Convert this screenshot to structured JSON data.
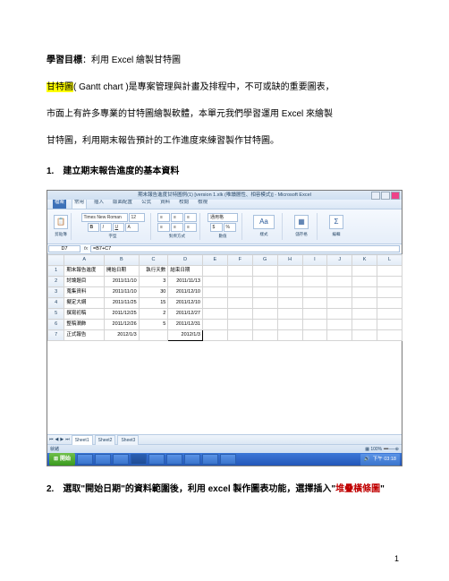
{
  "doc": {
    "heading_prefix": "學習目標",
    "heading_rest": "：利用 Excel 繪製甘特圖",
    "para1a": "甘特圖",
    "para1b": "( Gantt chart )是專案管理與計畫及排程中，不可或缺的重要圖表，",
    "para2": "市面上有許多專業的甘特圖繪製軟體，本單元我們學習運用 Excel 來繪製",
    "para3": "甘特圖，利用期末報告預計的工作進度來練習製作甘特圖。",
    "sec1": "1.　建立期末報告進度的基本資料",
    "sec2a": "2.　選取\"開始日期\"的資料範圍後，利用 excel 製作圖表功能，選擇插入\"",
    "sec2b": "堆疊橫條圖",
    "sec2c": "\"",
    "page_number": "1"
  },
  "excel": {
    "title": "期末報告進度甘特圖例(1) [version 1.xlk (唯讀層性、相容模式)] - Microsoft Excel",
    "qat": [
      "檔案",
      "常用",
      "插入",
      "版面配置",
      "公式",
      "資料",
      "校閱",
      "檢視"
    ],
    "font_name": "Times New Roman",
    "font_size": "12",
    "ribbon_groups": [
      "剪貼簿",
      "字型",
      "對齊方式",
      "數值",
      "樣式",
      "儲存格",
      "編輯"
    ],
    "namebox": "D7",
    "formula": "=B7+C7",
    "cols": [
      "",
      "A",
      "B",
      "C",
      "D",
      "E",
      "F",
      "G",
      "H",
      "I",
      "J",
      "K",
      "L"
    ],
    "rows": [
      {
        "n": "1",
        "cells": [
          "期末報告進度",
          "開始日期",
          "執行天數",
          "結束日期",
          "",
          "",
          "",
          "",
          "",
          "",
          "",
          ""
        ]
      },
      {
        "n": "2",
        "cells": [
          "討論題目",
          "2011/11/10",
          "3",
          "2011/11/13",
          "",
          "",
          "",
          "",
          "",
          "",
          "",
          ""
        ]
      },
      {
        "n": "3",
        "cells": [
          "蒐集資料",
          "2011/11/10",
          "30",
          "2011/12/10",
          "",
          "",
          "",
          "",
          "",
          "",
          "",
          ""
        ]
      },
      {
        "n": "4",
        "cells": [
          "擬定大綱",
          "2011/11/25",
          "15",
          "2011/12/10",
          "",
          "",
          "",
          "",
          "",
          "",
          "",
          ""
        ]
      },
      {
        "n": "5",
        "cells": [
          "撰寫初稿",
          "2011/12/25",
          "2",
          "2011/12/27",
          "",
          "",
          "",
          "",
          "",
          "",
          "",
          ""
        ]
      },
      {
        "n": "6",
        "cells": [
          "整稿潤飾",
          "2011/12/26",
          "5",
          "2011/12/31",
          "",
          "",
          "",
          "",
          "",
          "",
          "",
          ""
        ]
      },
      {
        "n": "7",
        "cells": [
          "正式報告",
          "2012/1/3",
          "",
          "2012/1/3",
          "",
          "",
          "",
          "",
          "",
          "",
          "",
          ""
        ]
      }
    ],
    "sheets": [
      "Sheet1",
      "Sheet2",
      "Sheet3"
    ],
    "status": "就緒",
    "zoom": "100%",
    "start": "開始",
    "clock": "下午 03:18"
  }
}
